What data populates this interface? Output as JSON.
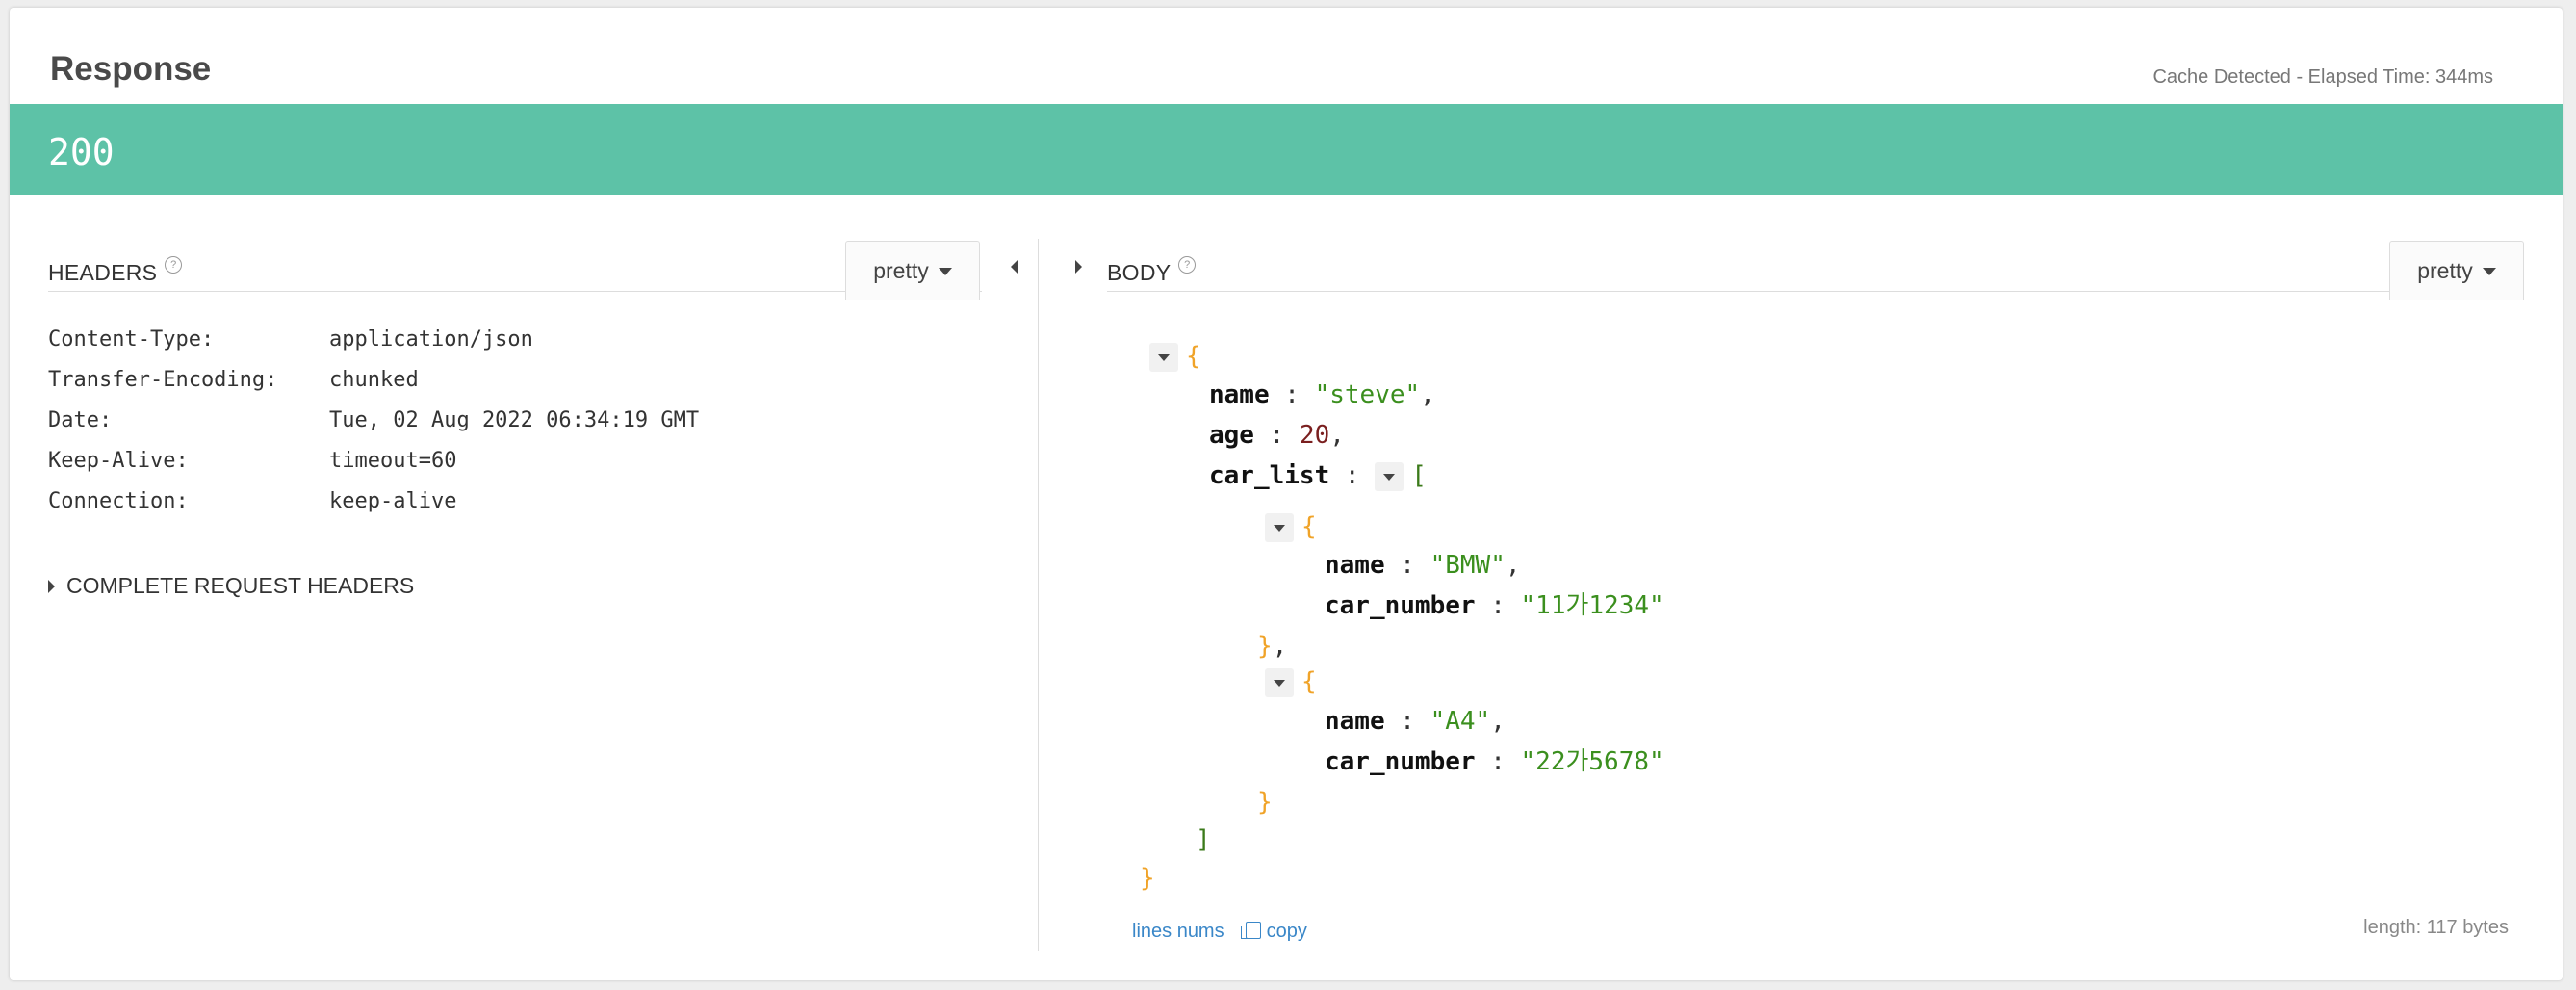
{
  "response": {
    "title": "Response",
    "elapsed": "Cache Detected - Elapsed Time: 344ms",
    "status_code": "200",
    "status_color": "#5dc2a7"
  },
  "headers_section": {
    "title": "HEADERS",
    "help_glyph": "?",
    "format_label": "pretty",
    "rows": [
      {
        "key": "Content-Type:",
        "value": "application/json"
      },
      {
        "key": "Transfer-Encoding:",
        "value": "chunked"
      },
      {
        "key": "Date:",
        "value": "Tue, 02 Aug 2022 06:34:19 GMT"
      },
      {
        "key": "Keep-Alive:",
        "value": "timeout=60"
      },
      {
        "key": "Connection:",
        "value": "keep-alive"
      }
    ],
    "complete_request_label": "COMPLETE REQUEST HEADERS"
  },
  "body_section": {
    "title": "BODY",
    "help_glyph": "?",
    "format_label": "pretty",
    "json": {
      "name_key": "name",
      "name_value": "\"steve\"",
      "age_key": "age",
      "age_value": "20",
      "car_list_key": "car_list",
      "cars": [
        {
          "name_key": "name",
          "name_value": "\"BMW\"",
          "number_key": "car_number",
          "number_value": "\"11가1234\""
        },
        {
          "name_key": "name",
          "name_value": "\"A4\"",
          "number_key": "car_number",
          "number_value": "\"22가5678\""
        }
      ]
    },
    "lines_nums_label": "lines nums",
    "copy_label": "copy",
    "length_label": "length: 117 bytes"
  }
}
